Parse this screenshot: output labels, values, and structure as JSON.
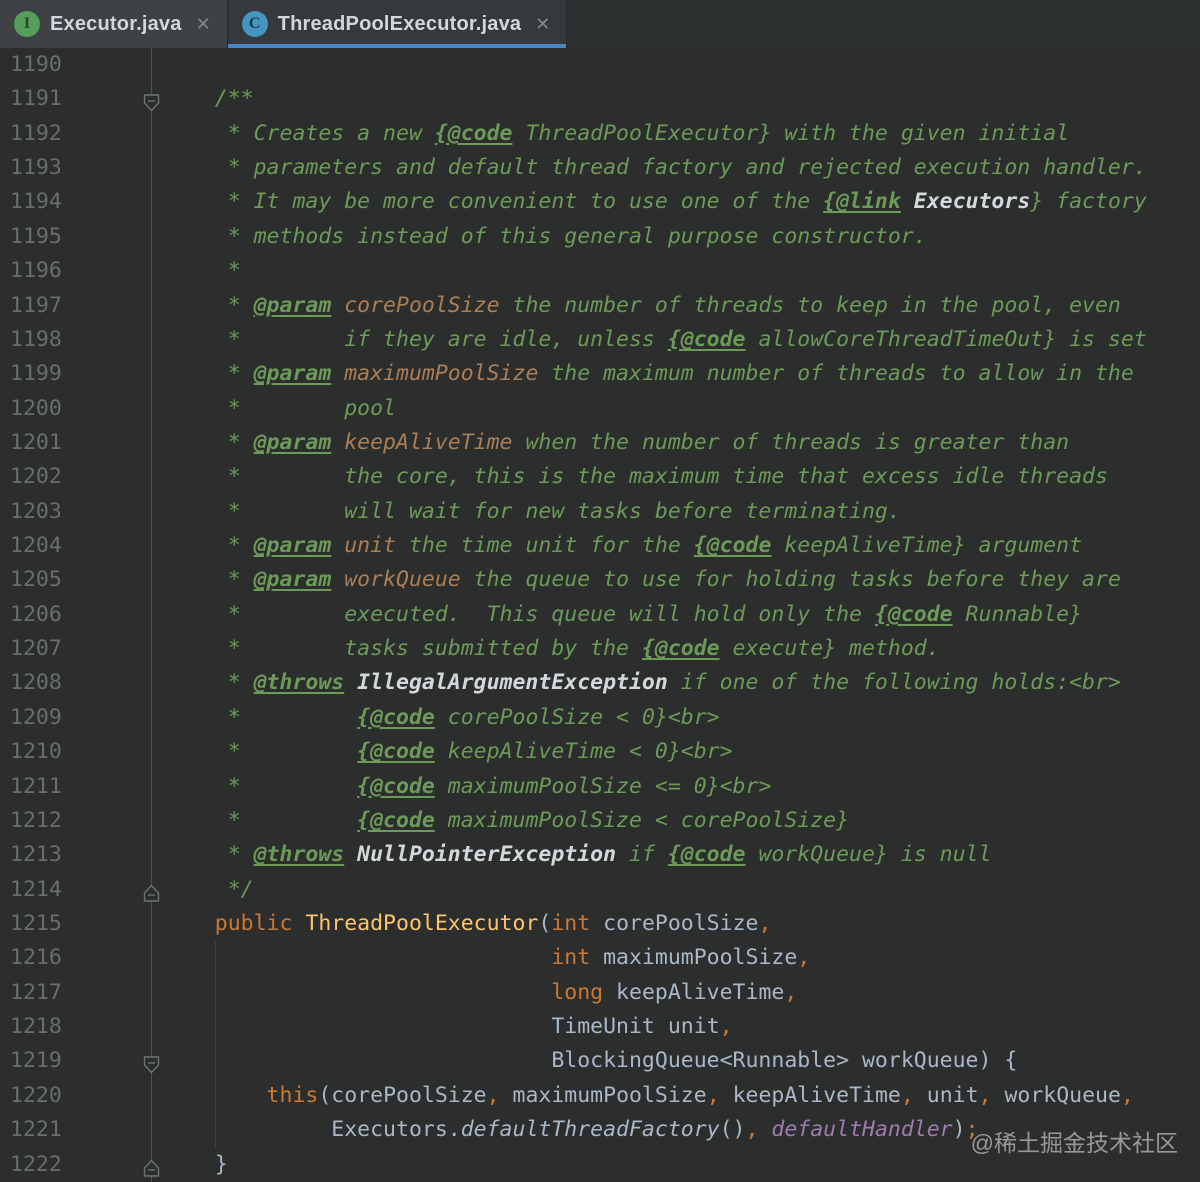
{
  "tabs": [
    {
      "label": "Executor.java",
      "icon_letter": "I",
      "icon_kind": "interface",
      "close": "✕",
      "active": false
    },
    {
      "label": "ThreadPoolExecutor.java",
      "icon_letter": "C",
      "icon_kind": "class",
      "close": "✕",
      "active": true
    }
  ],
  "colors": {
    "editor_background": "#2c2e2d",
    "active_tab_underline": "#4a86c4",
    "interface_icon_green": "#569e5b",
    "class_icon_blue": "#4694c0",
    "doc_comment_green": "#6c9a58",
    "tag_value_tan": "#ac7e55",
    "keyword_orange": "#cc7832",
    "method_yellow": "#fec56c",
    "plain_text": "#a9b7c6",
    "field_purple": "#9e7bb0",
    "line_number_gray": "#696d6f"
  },
  "watermark": "@稀土掘金技术社区",
  "editor": {
    "first_line": 1190,
    "last_line": 1222,
    "lines": [
      {
        "num": "1190",
        "fold": "",
        "segs": []
      },
      {
        "num": "1191",
        "fold": "start",
        "segs": [
          [
            "c",
            "    /**"
          ]
        ]
      },
      {
        "num": "1192",
        "fold": "",
        "segs": [
          [
            "c",
            "     * Creates a new "
          ],
          [
            "ct",
            "{@code"
          ],
          [
            "c",
            " ThreadPoolExecutor} with the given initial"
          ]
        ]
      },
      {
        "num": "1193",
        "fold": "",
        "segs": [
          [
            "c",
            "     * parameters and default thread factory and rejected execution handler."
          ]
        ]
      },
      {
        "num": "1194",
        "fold": "",
        "segs": [
          [
            "c",
            "     * It may be more convenient to use one of the "
          ],
          [
            "ct",
            "{@link"
          ],
          [
            "cc",
            " Executors"
          ],
          [
            "c",
            "} factory"
          ]
        ]
      },
      {
        "num": "1195",
        "fold": "",
        "segs": [
          [
            "c",
            "     * methods instead of this general purpose constructor."
          ]
        ]
      },
      {
        "num": "1196",
        "fold": "",
        "segs": [
          [
            "c",
            "     *"
          ]
        ]
      },
      {
        "num": "1197",
        "fold": "",
        "segs": [
          [
            "c",
            "     * "
          ],
          [
            "ct",
            "@param"
          ],
          [
            "cv",
            " corePoolSize"
          ],
          [
            "c",
            " the number of threads to keep in the pool, even"
          ]
        ]
      },
      {
        "num": "1198",
        "fold": "",
        "segs": [
          [
            "c",
            "     *        if they are idle, unless "
          ],
          [
            "ct",
            "{@code"
          ],
          [
            "c",
            " allowCoreThreadTimeOut} is set"
          ]
        ]
      },
      {
        "num": "1199",
        "fold": "",
        "segs": [
          [
            "c",
            "     * "
          ],
          [
            "ct",
            "@param"
          ],
          [
            "cv",
            " maximumPoolSize"
          ],
          [
            "c",
            " the maximum number of threads to allow in the"
          ]
        ]
      },
      {
        "num": "1200",
        "fold": "",
        "segs": [
          [
            "c",
            "     *        pool"
          ]
        ]
      },
      {
        "num": "1201",
        "fold": "",
        "segs": [
          [
            "c",
            "     * "
          ],
          [
            "ct",
            "@param"
          ],
          [
            "cv",
            " keepAliveTime"
          ],
          [
            "c",
            " when the number of threads is greater than"
          ]
        ]
      },
      {
        "num": "1202",
        "fold": "",
        "segs": [
          [
            "c",
            "     *        the core, this is the maximum time that excess idle threads"
          ]
        ]
      },
      {
        "num": "1203",
        "fold": "",
        "segs": [
          [
            "c",
            "     *        will wait for new tasks before terminating."
          ]
        ]
      },
      {
        "num": "1204",
        "fold": "",
        "segs": [
          [
            "c",
            "     * "
          ],
          [
            "ct",
            "@param"
          ],
          [
            "cv",
            " unit"
          ],
          [
            "c",
            " the time unit for the "
          ],
          [
            "ct",
            "{@code"
          ],
          [
            "c",
            " keepAliveTime} argument"
          ]
        ]
      },
      {
        "num": "1205",
        "fold": "",
        "segs": [
          [
            "c",
            "     * "
          ],
          [
            "ct",
            "@param"
          ],
          [
            "cv",
            " workQueue"
          ],
          [
            "c",
            " the queue to use for holding tasks before they are"
          ]
        ]
      },
      {
        "num": "1206",
        "fold": "",
        "segs": [
          [
            "c",
            "     *        executed.  This queue will hold only the "
          ],
          [
            "ct",
            "{@code"
          ],
          [
            "c",
            " Runnable}"
          ]
        ]
      },
      {
        "num": "1207",
        "fold": "",
        "segs": [
          [
            "c",
            "     *        tasks submitted by the "
          ],
          [
            "ct",
            "{@code"
          ],
          [
            "c",
            " execute} method."
          ]
        ]
      },
      {
        "num": "1208",
        "fold": "",
        "segs": [
          [
            "c",
            "     * "
          ],
          [
            "ct",
            "@throws"
          ],
          [
            "cc",
            " IllegalArgumentException"
          ],
          [
            "c",
            " if one of the following holds:<br>"
          ]
        ]
      },
      {
        "num": "1209",
        "fold": "",
        "segs": [
          [
            "c",
            "     *         "
          ],
          [
            "ct",
            "{@code"
          ],
          [
            "c",
            " corePoolSize < 0}<br>"
          ]
        ]
      },
      {
        "num": "1210",
        "fold": "",
        "segs": [
          [
            "c",
            "     *         "
          ],
          [
            "ct",
            "{@code"
          ],
          [
            "c",
            " keepAliveTime < 0}<br>"
          ]
        ]
      },
      {
        "num": "1211",
        "fold": "",
        "segs": [
          [
            "c",
            "     *         "
          ],
          [
            "ct",
            "{@code"
          ],
          [
            "c",
            " maximumPoolSize <= 0}<br>"
          ]
        ]
      },
      {
        "num": "1212",
        "fold": "",
        "segs": [
          [
            "c",
            "     *         "
          ],
          [
            "ct",
            "{@code"
          ],
          [
            "c",
            " maximumPoolSize < corePoolSize}"
          ]
        ]
      },
      {
        "num": "1213",
        "fold": "",
        "segs": [
          [
            "c",
            "     * "
          ],
          [
            "ct",
            "@throws"
          ],
          [
            "cc",
            " NullPointerException"
          ],
          [
            "c",
            " if "
          ],
          [
            "ct",
            "{@code"
          ],
          [
            "c",
            " workQueue} is null"
          ]
        ]
      },
      {
        "num": "1214",
        "fold": "end",
        "segs": [
          [
            "c",
            "     */"
          ]
        ]
      },
      {
        "num": "1215",
        "fold": "",
        "segs": [
          [
            "k",
            "    public "
          ],
          [
            "m",
            "ThreadPoolExecutor"
          ],
          [
            "p",
            "("
          ],
          [
            "k",
            "int"
          ],
          [
            "p",
            " corePoolSize"
          ],
          [
            "k",
            ","
          ]
        ]
      },
      {
        "num": "1216",
        "fold": "",
        "segs": [
          [
            "p",
            "                              "
          ],
          [
            "k",
            "int"
          ],
          [
            "p",
            " maximumPoolSize"
          ],
          [
            "k",
            ","
          ]
        ]
      },
      {
        "num": "1217",
        "fold": "",
        "segs": [
          [
            "p",
            "                              "
          ],
          [
            "k",
            "long"
          ],
          [
            "p",
            " keepAliveTime"
          ],
          [
            "k",
            ","
          ]
        ]
      },
      {
        "num": "1218",
        "fold": "",
        "segs": [
          [
            "p",
            "                              TimeUnit unit"
          ],
          [
            "k",
            ","
          ]
        ]
      },
      {
        "num": "1219",
        "fold": "start",
        "segs": [
          [
            "p",
            "                              BlockingQueue<Runnable> workQueue) {"
          ]
        ]
      },
      {
        "num": "1220",
        "fold": "",
        "segs": [
          [
            "k",
            "        this"
          ],
          [
            "p",
            "(corePoolSize"
          ],
          [
            "k",
            ","
          ],
          [
            "p",
            " maximumPoolSize"
          ],
          [
            "k",
            ","
          ],
          [
            "p",
            " keepAliveTime"
          ],
          [
            "k",
            ","
          ],
          [
            "p",
            " unit"
          ],
          [
            "k",
            ","
          ],
          [
            "p",
            " workQueue"
          ],
          [
            "k",
            ","
          ]
        ]
      },
      {
        "num": "1221",
        "fold": "",
        "segs": [
          [
            "p",
            "             Executors."
          ],
          [
            "sm",
            "defaultThreadFactory"
          ],
          [
            "p",
            "()"
          ],
          [
            "k",
            ","
          ],
          [
            "p",
            " "
          ],
          [
            "f",
            "defaultHandler"
          ],
          [
            "p",
            ")"
          ],
          [
            "k",
            ";"
          ]
        ]
      },
      {
        "num": "1222",
        "fold": "end",
        "segs": [
          [
            "p",
            "    }"
          ]
        ]
      }
    ]
  }
}
